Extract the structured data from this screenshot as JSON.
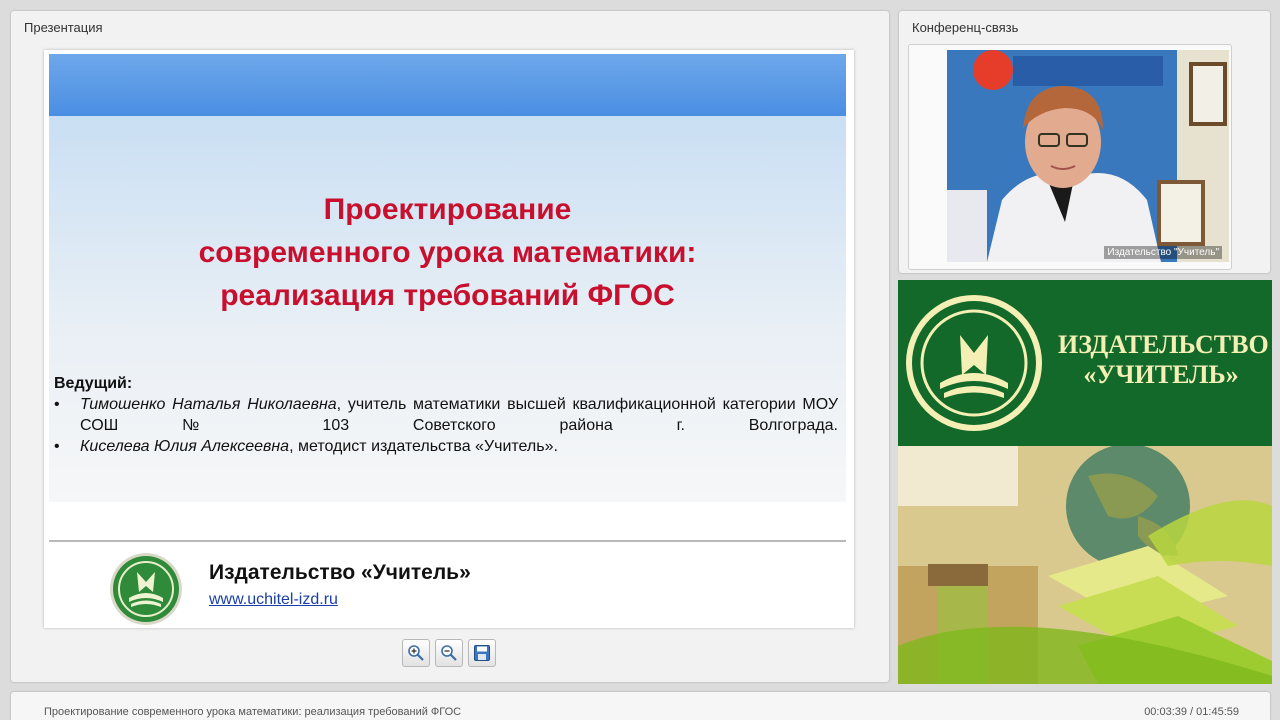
{
  "presentation": {
    "panel_title": "Презентация",
    "slide": {
      "title_lines": [
        "Проектирование",
        "современного урока математики:",
        "реализация требований ФГОС"
      ],
      "presenters_heading": "Ведущий:",
      "presenters": [
        {
          "name": "Тимошенко Наталья Николаевна",
          "description": ", учитель математики высшей квалификационной категории МОУ СОШ № 103 Советского района г. Волгограда."
        },
        {
          "name": "Киселева Юлия Алексеевна",
          "description": ", методист издательства «Учитель»."
        }
      ],
      "publisher_name": "Издательство «Учитель»",
      "publisher_url": "www.uchitel-izd.ru"
    },
    "toolbar": {
      "zoom_in_icon": "zoom-in-icon",
      "zoom_out_icon": "zoom-out-icon",
      "save_icon": "floppy-disk-icon"
    }
  },
  "conference": {
    "panel_title": "Конференц-связь",
    "video_caption": "Издательство \"Учитель\""
  },
  "banner": {
    "line1": "ИЗДАТЕЛЬСТВО",
    "line2": "«УЧИТЕЛЬ»",
    "color_bg": "#13692a",
    "color_text": "#f4efb5"
  },
  "bottom_bar": {
    "title": "Проектирование современного урока математики: реализация требований ФГОС",
    "time": "00:03:39 / 01:45:59"
  },
  "colors": {
    "slide_title": "#c8102e",
    "slide_topbar": "#4a8ee2",
    "link": "#1a3ea8"
  }
}
